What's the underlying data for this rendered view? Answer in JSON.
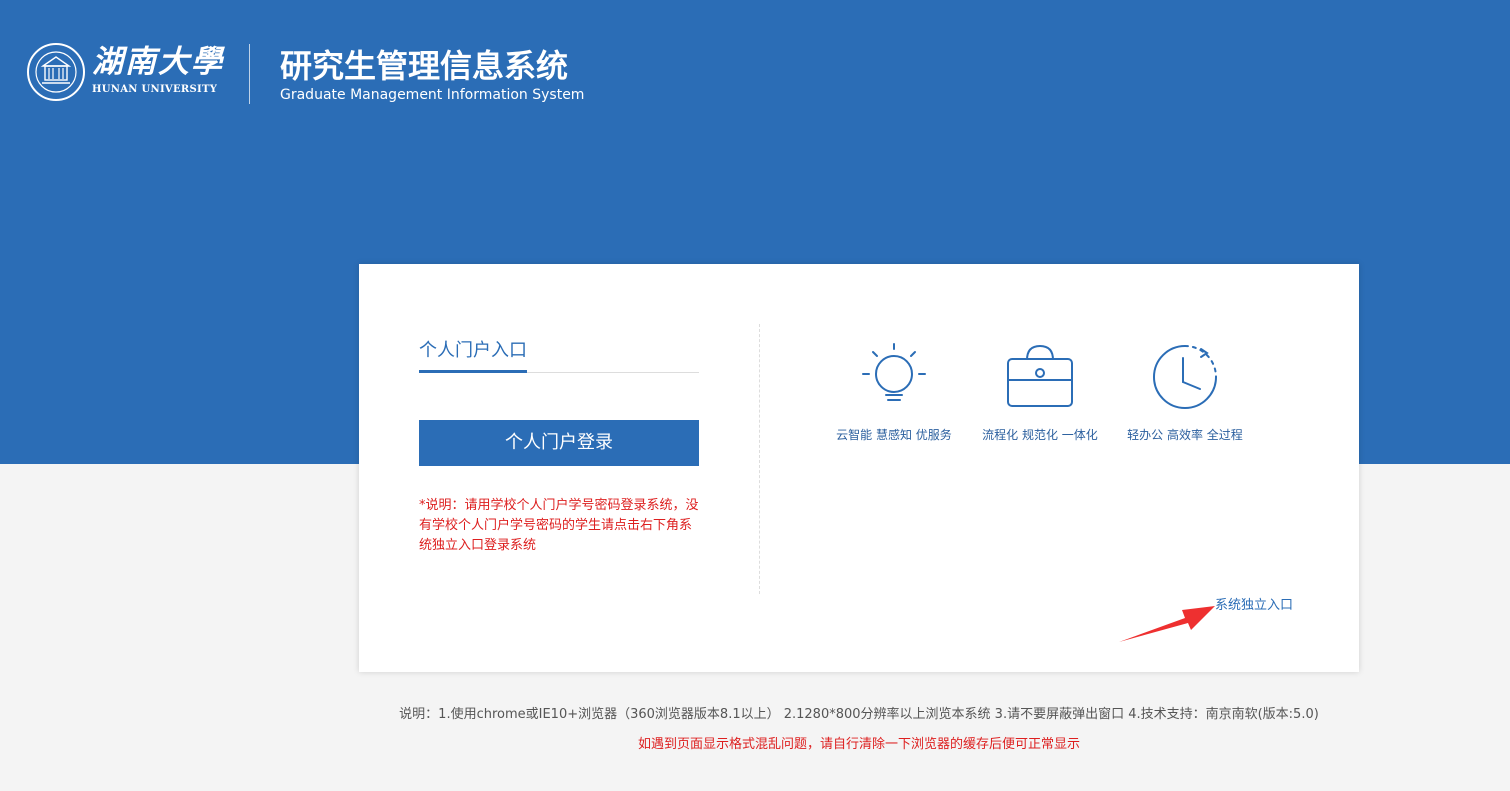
{
  "header": {
    "logo_calligraphy": "湖南大學",
    "university_en": "HUNAN UNIVERSITY",
    "title": "研究生管理信息系统",
    "subtitle": "Graduate Management Information System"
  },
  "login": {
    "tab_label": "个人门户入口",
    "button_label": "个人门户登录",
    "note": "*说明：请用学校个人门户学号密码登录系统，没有学校个人门户学号密码的学生请点击右下角系统独立入口登录系统"
  },
  "features": [
    {
      "icon": "lightbulb-icon",
      "caption": "云智能 慧感知 优服务"
    },
    {
      "icon": "briefcase-icon",
      "caption": "流程化 规范化 一体化"
    },
    {
      "icon": "clock-icon",
      "caption": "轻办公 高效率 全过程"
    }
  ],
  "standalone_link": "系统独立入口",
  "footer": {
    "info": "说明：1.使用chrome或IE10+浏览器（360浏览器版本8.1以上） 2.1280*800分辨率以上浏览本系统 3.请不要屏蔽弹出窗口 4.技术支持：南京南软(版本:5.0)",
    "warning": "如遇到页面显示格式混乱问题，请自行清除一下浏览器的缓存后便可正常显示"
  },
  "colors": {
    "brand_blue": "#2b6db6",
    "warning_red": "#dd1f1f",
    "page_bg": "#f4f4f4"
  }
}
